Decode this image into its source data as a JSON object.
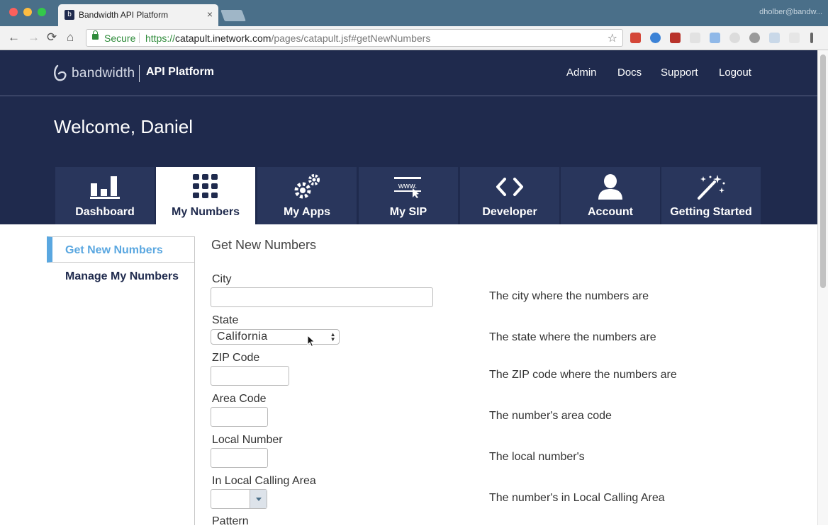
{
  "browser": {
    "tab_title": "Bandwidth API Platform",
    "tab_close": "×",
    "profile_name": "dholber@bandw...",
    "secure_label": "Secure",
    "url_scheme": "https://",
    "url_host": "catapult.inetwork.com",
    "url_path": "/pages/catapult.jsf#getNewNumbers",
    "back_icon": "←",
    "forward_icon": "→",
    "reload_icon": "⟳",
    "home_icon": "⌂",
    "star_icon": "☆"
  },
  "header": {
    "logo_word": "bandwidth",
    "product": "API Platform",
    "links": [
      "Admin",
      "Docs",
      "Support",
      "Logout"
    ]
  },
  "hero": {
    "welcome": "Welcome, Daniel"
  },
  "nav_tabs": [
    {
      "label": "Dashboard",
      "icon": "bar-chart-icon"
    },
    {
      "label": "My Numbers",
      "icon": "keypad-grid-icon",
      "active": true
    },
    {
      "label": "My Apps",
      "icon": "gears-icon"
    },
    {
      "label": "My SIP",
      "icon": "www-browser-icon"
    },
    {
      "label": "Developer",
      "icon": "code-brackets-icon"
    },
    {
      "label": "Account",
      "icon": "user-silhouette-icon"
    },
    {
      "label": "Getting Started",
      "icon": "magic-wand-icon"
    }
  ],
  "sidebar": {
    "items": [
      "Get New Numbers",
      "Manage My Numbers"
    ]
  },
  "form": {
    "title": "Get New Numbers",
    "city_label": "City",
    "city_desc": "The city where the numbers are",
    "state_label": "State",
    "state_value": "California",
    "state_desc": "The state where the numbers are",
    "zip_label": "ZIP Code",
    "zip_desc": "The ZIP code where the numbers are",
    "area_label": "Area Code",
    "area_desc": "The number's area code",
    "local_label": "Local Number",
    "local_desc": "The local number's",
    "calling_label": "In Local Calling Area",
    "calling_desc": "The number's in Local Calling Area",
    "pattern_label": "Pattern"
  },
  "colors": {
    "brand_navy": "#1f2a4d",
    "accent_blue": "#5aa7e0"
  }
}
